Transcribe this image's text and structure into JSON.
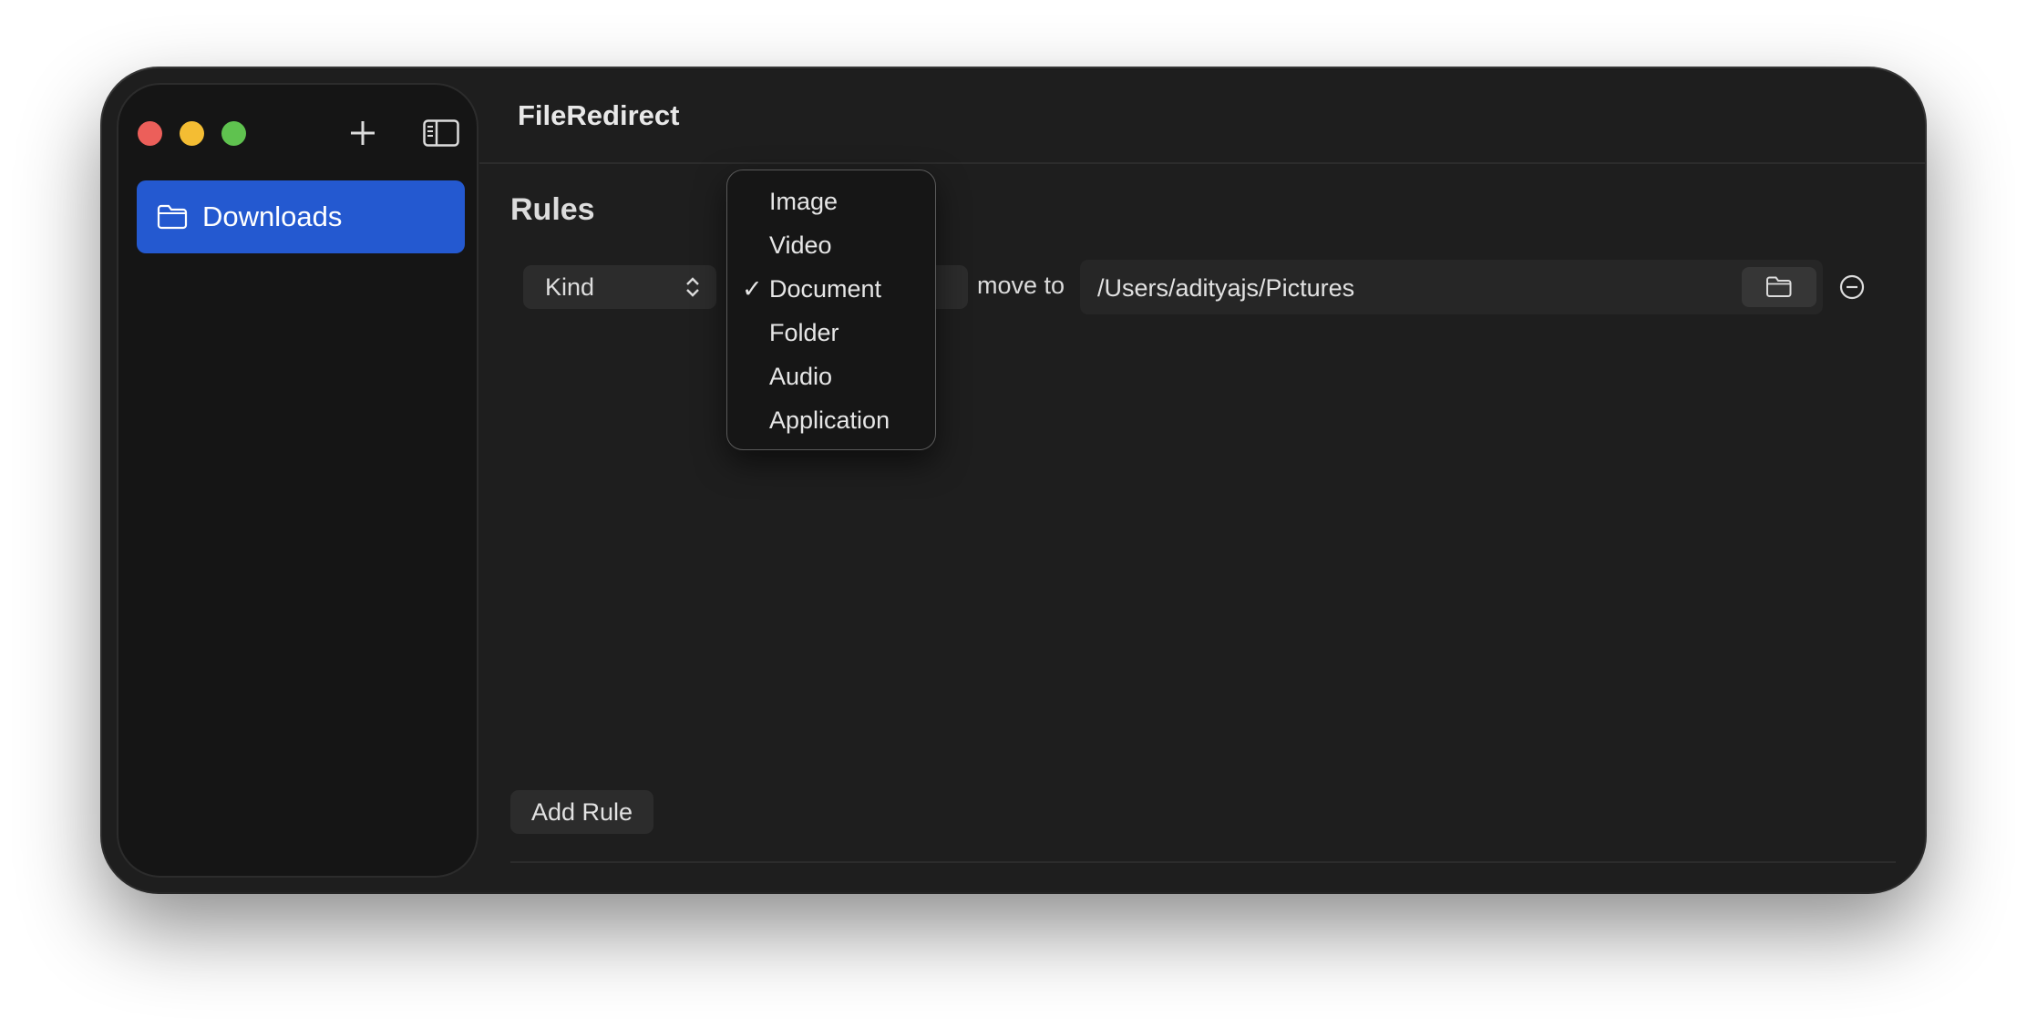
{
  "window": {
    "title": "FileRedirect"
  },
  "sidebar": {
    "items": [
      {
        "label": "Downloads",
        "icon": "folder-icon",
        "selected": true
      }
    ],
    "accent_color": "#2459d0"
  },
  "main": {
    "heading": "Rules",
    "rule": {
      "attribute": "Kind",
      "action_label": "move to",
      "destination_path": "/Users/adityajs/Pictures"
    },
    "add_rule_label": "Add Rule"
  },
  "kind_menu": {
    "selected": "Document",
    "check_glyph": "✓",
    "options": [
      "Image",
      "Video",
      "Document",
      "Folder",
      "Audio",
      "Application"
    ]
  }
}
